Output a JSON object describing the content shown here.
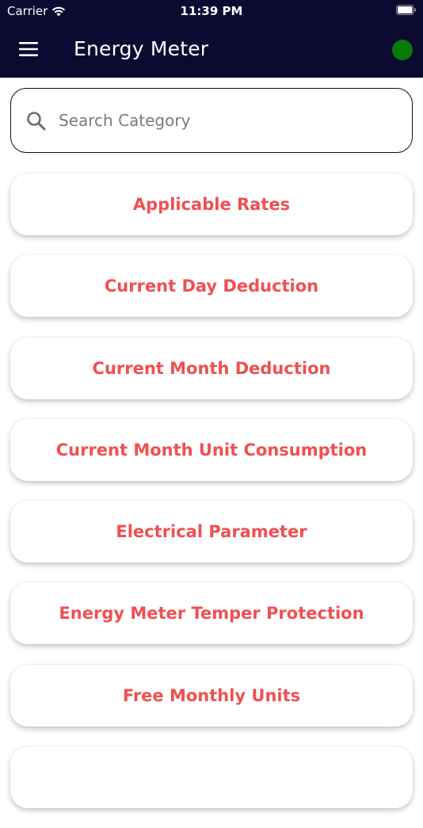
{
  "status_bar": {
    "carrier": "Carrier",
    "time": "11:39 PM"
  },
  "toolbar": {
    "title": "Energy Meter",
    "status_dot_color": "#0a7a0a",
    "background_color": "#0c0a31"
  },
  "search": {
    "placeholder": "Search Category",
    "value": ""
  },
  "categories": [
    {
      "label": "Applicable Rates"
    },
    {
      "label": "Current Day Deduction"
    },
    {
      "label": "Current Month Deduction"
    },
    {
      "label": "Current Month Unit Consumption"
    },
    {
      "label": "Electrical Parameter"
    },
    {
      "label": "Energy Meter Temper Protection"
    },
    {
      "label": "Free Monthly Units"
    },
    {
      "label": ""
    }
  ],
  "colors": {
    "accent": "#f05050",
    "header": "#0c0a31",
    "status_online": "#0a7a0a"
  },
  "icons": {
    "menu": "hamburger-menu-icon",
    "search": "search-icon",
    "wifi": "wifi-icon",
    "battery": "battery-icon"
  }
}
